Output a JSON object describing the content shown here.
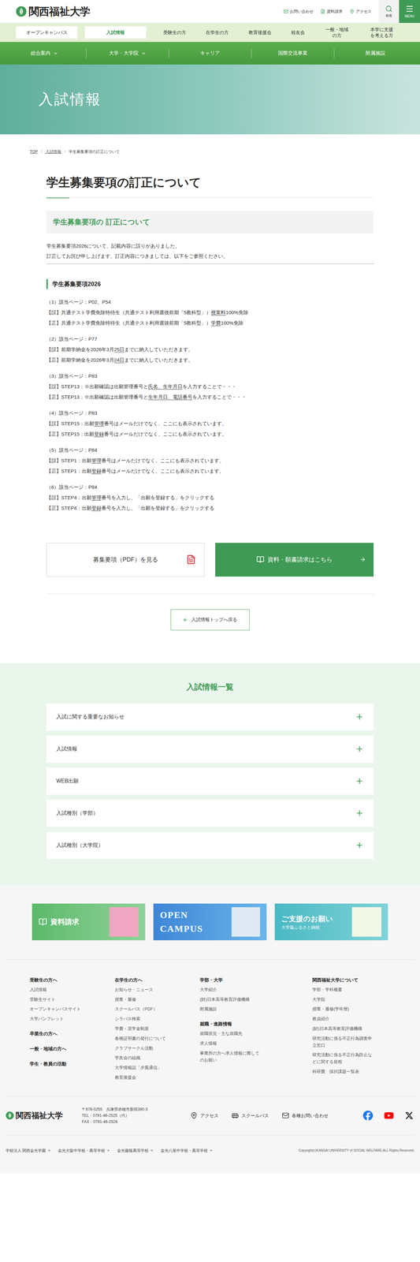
{
  "header": {
    "logo": "関西福祉大学",
    "links": [
      "お問い合わせ",
      "資料請求",
      "アクセス"
    ],
    "search": "検索",
    "menu": "MENU"
  },
  "audience_nav": [
    {
      "label": "オープンキャンパス",
      "kind": "pill",
      "selected": false
    },
    {
      "label": "入試情報",
      "kind": "pill",
      "selected": true
    },
    {
      "label": "受験生の方",
      "kind": "link",
      "selected": false
    },
    {
      "label": "在学生の方",
      "kind": "link",
      "selected": false
    },
    {
      "label": "教育後援会",
      "kind": "link",
      "selected": false
    },
    {
      "label": "校友会",
      "kind": "link",
      "selected": false
    },
    {
      "label": "一般・地域の方",
      "kind": "link",
      "selected": false
    },
    {
      "label": "本学に支援を考える方",
      "kind": "link",
      "selected": false
    }
  ],
  "main_nav": [
    {
      "label": "総合案内",
      "dropdown": true
    },
    {
      "label": "大学・大学院",
      "dropdown": true
    },
    {
      "label": "キャリア",
      "dropdown": false
    },
    {
      "label": "国際交流事業",
      "dropdown": false
    },
    {
      "label": "附属施設",
      "dropdown": false
    }
  ],
  "hero": {
    "title": "入試情報"
  },
  "breadcrumb": {
    "items": [
      "TOP",
      "入試情報",
      "学生募集要項の訂正について"
    ],
    "separator": "/"
  },
  "page_title": "学生募集要項の訂正について",
  "section_title": "学生募集要項の 訂正について",
  "intro": [
    "学生募集要項2026について、記載内容に誤りがありました。",
    "訂正してお詫び申し上げます。訂正内容につきましては、以下をご参照ください。"
  ],
  "corrections": {
    "heading": "学生募集要項2026",
    "items": [
      {
        "page": "（1）該当ページ：P02、P54",
        "lines": [
          {
            "label": "【誤】",
            "parts": [
              {
                "text": "共通テスト学費免除特待生（共通テスト利用選抜前期「5教科型」）",
                "underline": false
              },
              {
                "text": "授業料",
                "underline": true
              },
              {
                "text": "100%免除",
                "underline": false
              }
            ]
          },
          {
            "label": "【正】",
            "parts": [
              {
                "text": "共通テスト学費免除特待生（共通テスト利用選抜前期「5教科型」）",
                "underline": false
              },
              {
                "text": "学費",
                "underline": true
              },
              {
                "text": "100%免除",
                "underline": false
              }
            ]
          }
        ]
      },
      {
        "page": "（2）該当ページ：P77",
        "lines": [
          {
            "label": "【誤】",
            "parts": [
              {
                "text": "前期学納金を2026年3月",
                "underline": false
              },
              {
                "text": "25日",
                "underline": true
              },
              {
                "text": "までに納入していただきます。",
                "underline": false
              }
            ]
          },
          {
            "label": "【正】",
            "parts": [
              {
                "text": "前期学納金を2026年3月",
                "underline": false
              },
              {
                "text": "24日",
                "underline": true
              },
              {
                "text": "までに納入していただきます。",
                "underline": false
              }
            ]
          }
        ]
      },
      {
        "page": "（3）該当ページ：P83",
        "lines": [
          {
            "label": "【誤】",
            "parts": [
              {
                "text": "STEP13：※出願確認は出願管理番号と",
                "underline": false
              },
              {
                "text": "氏名、生年月日",
                "underline": true
              },
              {
                "text": "を入力することで・・・",
                "underline": false
              }
            ]
          },
          {
            "label": "【正】",
            "parts": [
              {
                "text": "STEP13：※出願確認は出願管理番号と",
                "underline": false
              },
              {
                "text": "生年月日、電話番号",
                "underline": true
              },
              {
                "text": "を入力することで・・・",
                "underline": false
              }
            ]
          }
        ]
      },
      {
        "page": "（4）該当ページ：P83",
        "lines": [
          {
            "label": "【誤】",
            "parts": [
              {
                "text": "STEP15：出願",
                "underline": false
              },
              {
                "text": "管理",
                "underline": true
              },
              {
                "text": "番号はメールだけでなく、ここにも表示されています。",
                "underline": false
              }
            ]
          },
          {
            "label": "【正】",
            "parts": [
              {
                "text": "STEP15：出願",
                "underline": false
              },
              {
                "text": "登録",
                "underline": true
              },
              {
                "text": "番号はメールだけでなく、ここにも表示されています。",
                "underline": false
              }
            ]
          }
        ]
      },
      {
        "page": "（5）該当ページ：P84",
        "lines": [
          {
            "label": "【誤】",
            "parts": [
              {
                "text": "STEP1：出願",
                "underline": false
              },
              {
                "text": "管理",
                "underline": true
              },
              {
                "text": "番号はメールだけでなく、ここにも表示されています。",
                "underline": false
              }
            ]
          },
          {
            "label": "【正】",
            "parts": [
              {
                "text": "STEP1：出願",
                "underline": false
              },
              {
                "text": "登録",
                "underline": true
              },
              {
                "text": "番号はメールだけでなく、ここにも表示されています。",
                "underline": false
              }
            ]
          }
        ]
      },
      {
        "page": "（6）該当ページ：P84",
        "lines": [
          {
            "label": "【誤】",
            "parts": [
              {
                "text": "STEP4：出願",
                "underline": false
              },
              {
                "text": "管理",
                "underline": true
              },
              {
                "text": "番号を入力し、「出願を登録する」をクリックする",
                "underline": false
              }
            ]
          },
          {
            "label": "【正】",
            "parts": [
              {
                "text": "STEP4：出願",
                "underline": false
              },
              {
                "text": "登録",
                "underline": true
              },
              {
                "text": "番号を入力し、「出願を登録する」をクリックする",
                "underline": false
              }
            ]
          }
        ]
      }
    ]
  },
  "buttons": {
    "pdf": "募集要項（PDF）を見る",
    "request": "資料・願書請求はこちら",
    "back": "入試情報トップへ戻る"
  },
  "exam_list": {
    "title": "入試情報一覧",
    "items": [
      {
        "label": "入試に関する重要なお知らせ",
        "expanded": false
      },
      {
        "label": "入試情報",
        "expanded": false
      },
      {
        "label": "WEB出願",
        "expanded": false
      },
      {
        "label": "入試種別（学部）",
        "expanded": false
      },
      {
        "label": "入試種別（大学院）",
        "expanded": false
      }
    ]
  },
  "banners": [
    {
      "kind": "request",
      "title": "資料請求",
      "subtitle": ""
    },
    {
      "kind": "campus",
      "title": "OPEN CAMPUS",
      "subtitle": ""
    },
    {
      "kind": "support",
      "title": "ご支援のお願い",
      "subtitle": "大学版ふるさと納税"
    }
  ],
  "footer": {
    "columns": [
      [
        {
          "heading": "受験生の方へ",
          "links": [
            "入試情報",
            "受験生サイト",
            "オープンキャンパスサイト",
            "大学パンフレット"
          ]
        },
        {
          "heading": "卒業生の方へ",
          "links": []
        },
        {
          "heading": "一般・地域の方へ",
          "links": []
        },
        {
          "heading": "学生・教員の活動",
          "links": []
        }
      ],
      [
        {
          "heading": "在学生の方へ",
          "links": [
            "お知らせ・ニュース",
            "授業・履修",
            "スクールバス（PDF）",
            "シラバス検索",
            "学費・奨学金制度",
            "各種証明書の発行について",
            "クラブサークル活動",
            "学友会の組織",
            "大学情報誌「夕風通信」",
            "教育後援会"
          ]
        }
      ],
      [
        {
          "heading": "学部・大学",
          "links": [
            "大学紹介",
            "(財)日本高等教育評価機構",
            "附属施設"
          ]
        },
        {
          "heading": "就職・進路情報",
          "links": [
            "就職状況・主な就職先",
            "求人情報",
            "事業所の方へ求人情報に際してのお願い"
          ]
        }
      ],
      [
        {
          "heading": "関西福祉大学について",
          "links": [
            "学部・学科概要",
            "大学院",
            "授業・履修(学年暦)",
            "教員紹介",
            "(財)日本高等教育評価機構",
            "研究活動に係る不正行為調査申立窓口",
            "研究活動に係る不正行為防止などに関する規程",
            "科研費　採択課題一覧表"
          ]
        }
      ]
    ],
    "logo": "関西福祉大学",
    "address": [
      "〒678-0255　兵庫県赤穂市新田380-3",
      "TEL：0791-46-2525（代）",
      "FAX：0791-46-2526"
    ],
    "utility_links": [
      {
        "kind": "access",
        "label": "アクセス"
      },
      {
        "kind": "bus",
        "label": "スクールバス"
      },
      {
        "kind": "mail",
        "label": "各種お問い合わせ"
      }
    ],
    "social": [
      {
        "kind": "facebook",
        "color": "#1877f2"
      },
      {
        "kind": "youtube",
        "color": "#ff0000"
      },
      {
        "kind": "x",
        "color": "#111111"
      }
    ],
    "group_links": [
      "学校法人 関西金光学園",
      "金光大阪中学校・高等学校",
      "金光藤蔭高等学校",
      "金光八尾中学校・高等学校"
    ],
    "copyright": "Copyright(c)KANSAI UNIVERSITY of SOCIAL WELFARE.ALL Rights Reserved."
  }
}
